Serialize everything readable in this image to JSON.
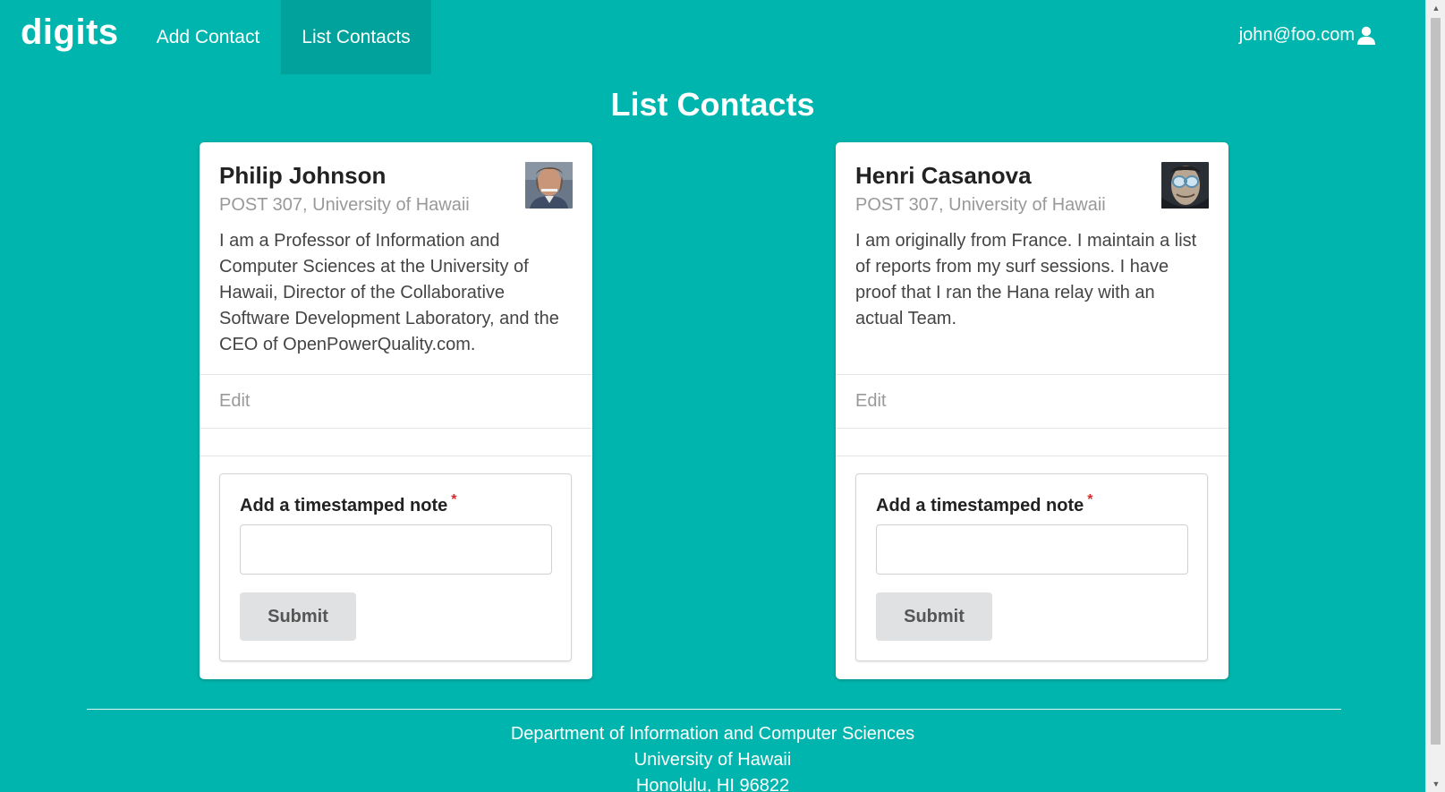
{
  "navbar": {
    "brand": "digits",
    "items": [
      {
        "label": "Add Contact"
      },
      {
        "label": "List Contacts",
        "active": true
      }
    ],
    "user": "john@foo.com",
    "user_icon": "user-icon"
  },
  "page_title": "List Contacts",
  "contacts": [
    {
      "name": "Philip Johnson",
      "address": "POST 307, University of Hawaii",
      "description": "I am a Professor of Information and Computer Sciences at the University of Hawaii, Director of the Collaborative Software Development Laboratory, and the CEO of OpenPowerQuality.com.",
      "edit_label": "Edit",
      "note_label": "Add a timestamped note",
      "note_required_mark": "*",
      "note_value": "",
      "submit_label": "Submit"
    },
    {
      "name": "Henri Casanova",
      "address": "POST 307, University of Hawaii",
      "description": "I am originally from France. I maintain a list of reports from my surf sessions. I have proof that I ran the Hana relay with an actual Team.",
      "edit_label": "Edit",
      "note_label": "Add a timestamped note",
      "note_required_mark": "*",
      "note_value": "",
      "submit_label": "Submit"
    }
  ],
  "footer": {
    "line1": "Department of Information and Computer Sciences",
    "line2": "University of Hawaii",
    "line3": "Honolulu, HI 96822"
  },
  "colors": {
    "background": "#00b5ad",
    "card": "#ffffff",
    "button": "#e0e1e2",
    "required": "#db2828"
  }
}
